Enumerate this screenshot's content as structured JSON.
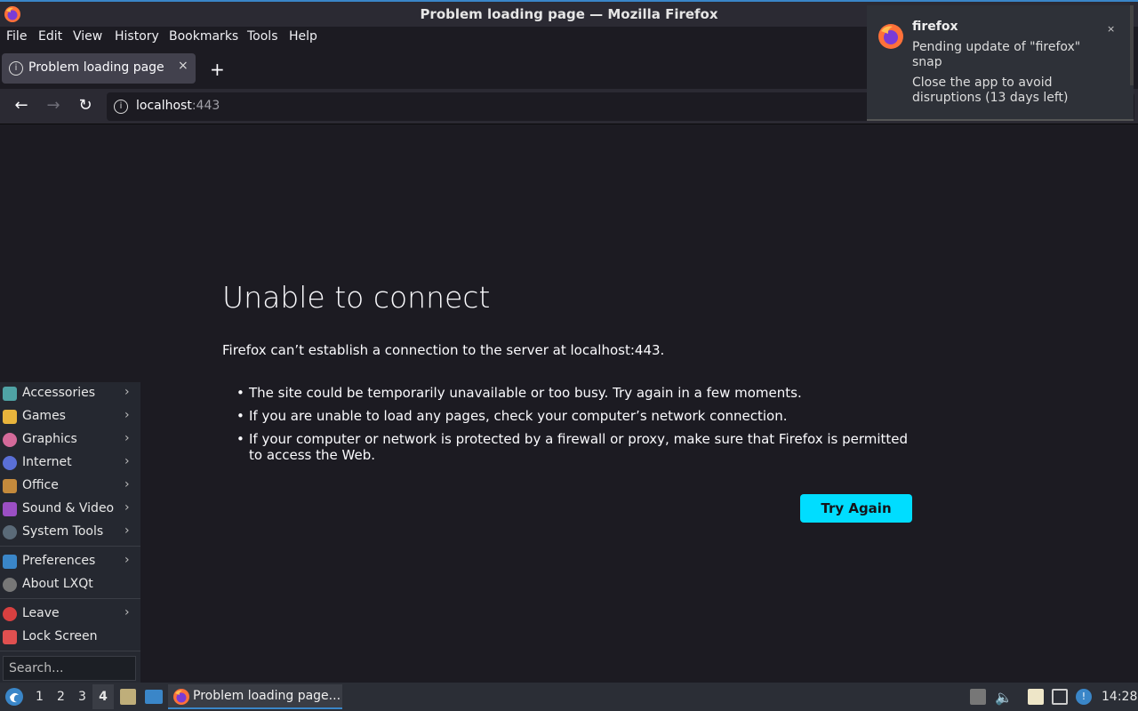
{
  "window": {
    "title": "Problem loading page — Mozilla Firefox"
  },
  "menubar": {
    "items": [
      "File",
      "Edit",
      "View",
      "History",
      "Bookmarks",
      "Tools",
      "Help"
    ]
  },
  "tabs": [
    {
      "label": "Problem loading page",
      "close": "×"
    }
  ],
  "newtab": "+",
  "nav": {
    "back": "←",
    "forward": "→",
    "reload": "↻",
    "host": "localhost",
    "port": ":443"
  },
  "error": {
    "title": "Unable to connect",
    "description": "Firefox can’t establish a connection to the server at localhost:443.",
    "bullets": [
      "The site could be temporarily unavailable or too busy. Try again in a few moments.",
      "If you are unable to load any pages, check your computer’s network connection.",
      "If your computer or network is protected by a firewall or proxy, make sure that Firefox is permitted to access the Web."
    ],
    "button": "Try Again"
  },
  "notification": {
    "app": "firefox",
    "line1": "Pending update of \"firefox\" snap",
    "line2": "Close the app to avoid disruptions (13 days left)",
    "close": "×"
  },
  "app_menu": {
    "items": [
      {
        "label": "Accessories",
        "icon": "accessories-icon",
        "color": "#4fa3a5",
        "submenu": true
      },
      {
        "label": "Games",
        "icon": "games-icon",
        "color": "#e8b43c",
        "submenu": true
      },
      {
        "label": "Graphics",
        "icon": "graphics-icon",
        "color": "#d46a9a",
        "submenu": true
      },
      {
        "label": "Internet",
        "icon": "internet-icon",
        "color": "#5a6fd6",
        "submenu": true
      },
      {
        "label": "Office",
        "icon": "office-icon",
        "color": "#c48a3c",
        "submenu": true
      },
      {
        "label": "Sound & Video",
        "icon": "sound-video-icon",
        "color": "#9b4fc4",
        "submenu": true
      },
      {
        "label": "System Tools",
        "icon": "system-tools-icon",
        "color": "#5a6a78",
        "submenu": true
      },
      {
        "label": "Preferences",
        "icon": "preferences-icon",
        "color": "#3a86c8",
        "submenu": true
      },
      {
        "label": "About LXQt",
        "icon": "info-icon",
        "color": "#777777",
        "submenu": false
      },
      {
        "label": "Leave",
        "icon": "power-icon",
        "color": "#d84040",
        "submenu": true
      },
      {
        "label": "Lock Screen",
        "icon": "lock-icon",
        "color": "#e05050",
        "submenu": false
      }
    ],
    "search_placeholder": "Search...",
    "arrow": "›"
  },
  "taskbar": {
    "desktops": [
      "1",
      "2",
      "3",
      "4"
    ],
    "active_desktop": "4",
    "task_label": "Problem loading page...",
    "clock": "14:28"
  }
}
